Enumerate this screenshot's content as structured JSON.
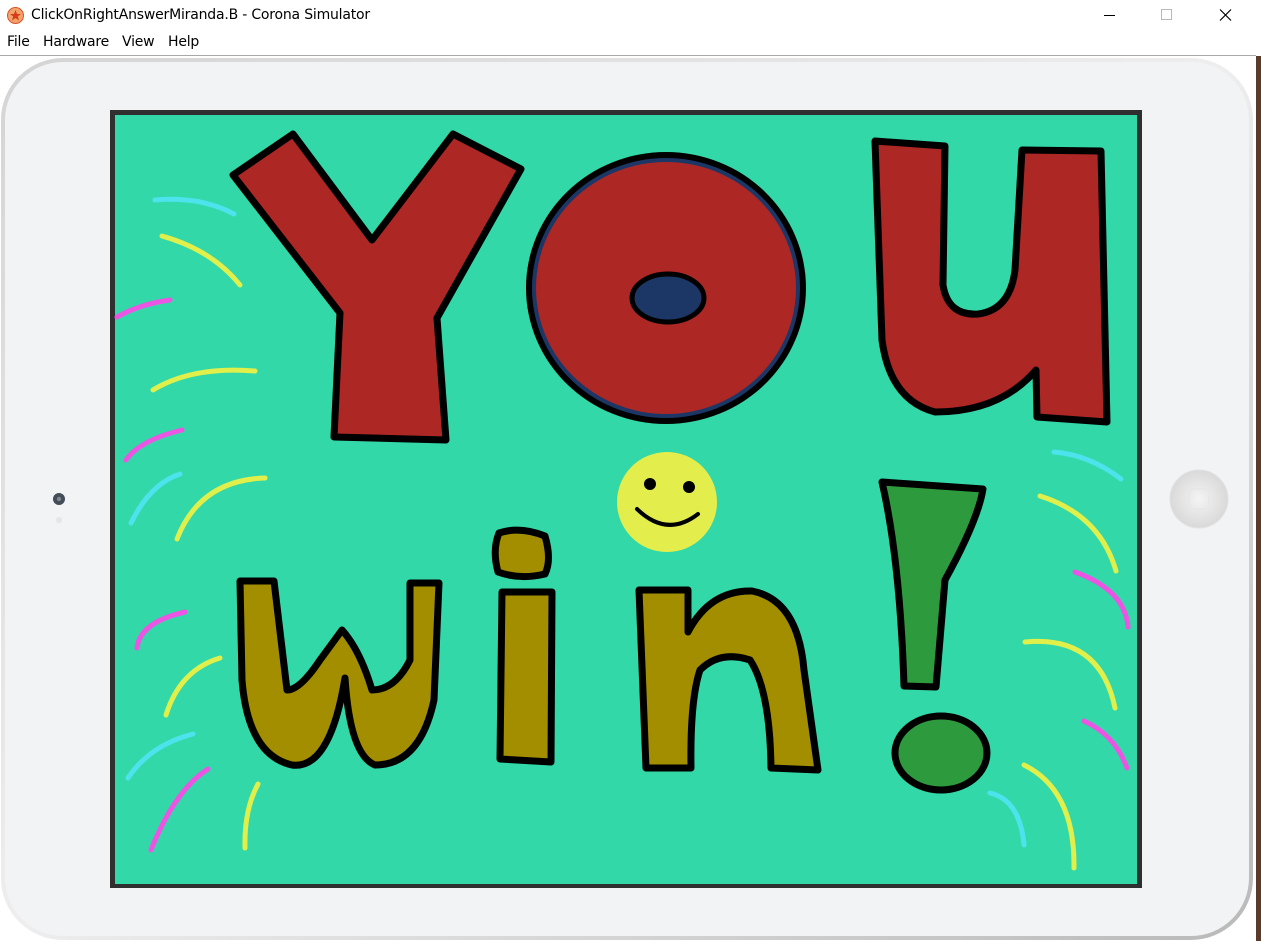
{
  "window": {
    "title": "ClickOnRightAnswerMiranda.B - Corona Simulator",
    "icon": "corona-app-icon",
    "controls": [
      "minimize-icon",
      "maximize-icon",
      "close-icon"
    ]
  },
  "menu": {
    "items": [
      {
        "label": "File"
      },
      {
        "label": "Hardware"
      },
      {
        "label": "View"
      },
      {
        "label": "Help"
      }
    ]
  },
  "device": {
    "type": "tablet",
    "home_button_icon": "home-button-icon",
    "camera_icon": "camera-icon"
  },
  "game": {
    "screen": "win-screen",
    "background": "#33d8a9",
    "word_you": {
      "letters": [
        "Y",
        "O",
        "U"
      ],
      "color": "#ad2725",
      "inner_color": "#1c3765"
    },
    "word_win": {
      "letters": [
        "w",
        "i",
        "n"
      ],
      "color": "#a38e00"
    },
    "exclamation_color": "#2e9a3e",
    "smiley_color": "#e3ee4c",
    "accent_colors": [
      "#4ce3ec",
      "#e0ef4a",
      "#ec55e4"
    ]
  }
}
